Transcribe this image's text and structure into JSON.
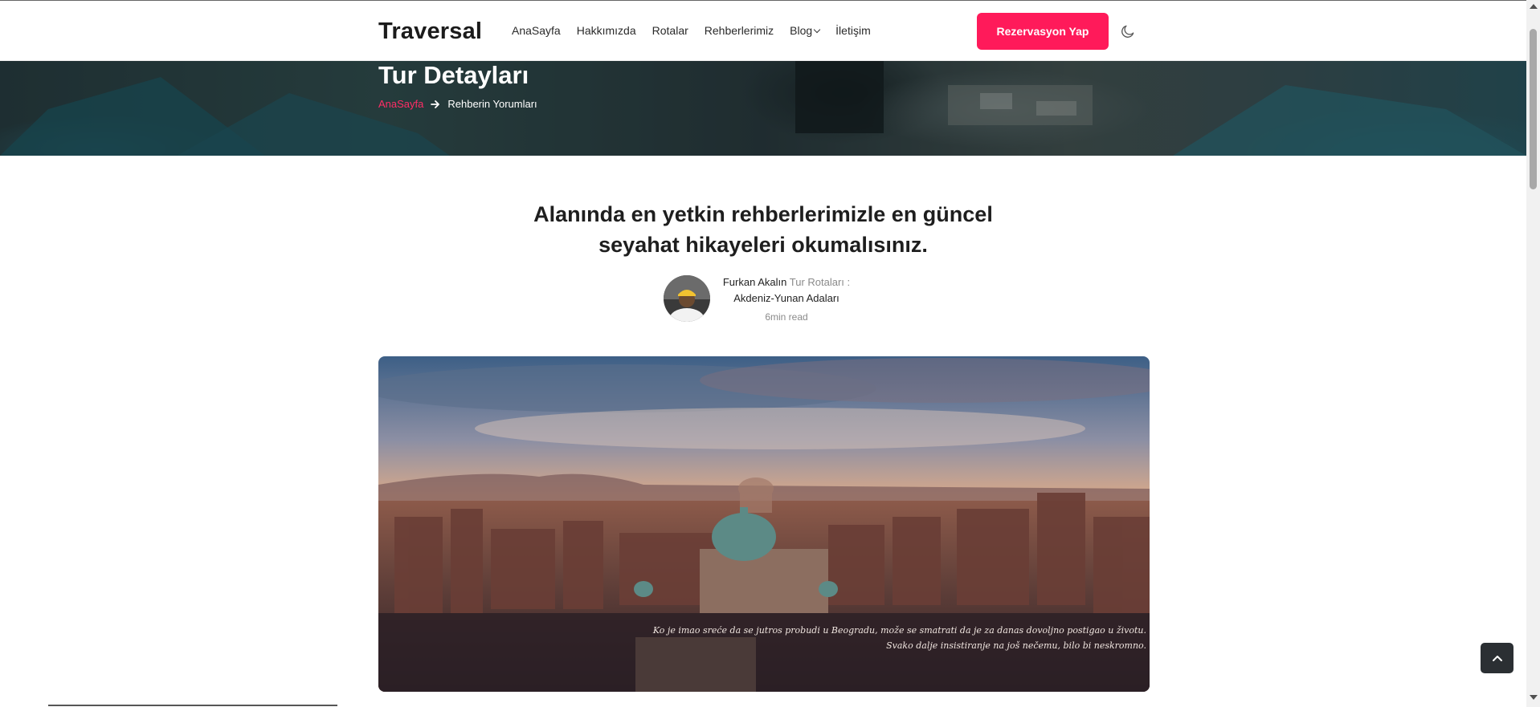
{
  "header": {
    "logo": "Traversal",
    "nav": [
      {
        "label": "AnaSayfa"
      },
      {
        "label": "Hakkımızda"
      },
      {
        "label": "Rotalar"
      },
      {
        "label": "Rehberlerimiz"
      },
      {
        "label": "Blog",
        "has_dropdown": true
      },
      {
        "label": "İletişim"
      }
    ],
    "cta_label": "Rezervasyon Yap",
    "theme_icon": "moon-icon",
    "accent_color": "#ff1a5a"
  },
  "hero": {
    "title": "Tur Detayları",
    "breadcrumb": {
      "home": "AnaSayfa",
      "separator_icon": "arrow-right-icon",
      "current": "Rehberin Yorumları"
    }
  },
  "article": {
    "headline_line1": "Alanında en yetkin rehberlerimizle en güncel",
    "headline_line2": "seyahat hikayeleri okumalısınız.",
    "author": {
      "name": "Furkan Akalın",
      "category_label": "Tur Rotaları :",
      "route": "Akdeniz-Yunan Adaları",
      "read_time": "6min read"
    },
    "image_caption_line1": "Ko je imao sreće da se jutros probudi u Beogradu, može se smatrati da je za danas dovoljno postigao u životu.",
    "image_caption_line2": "Svako dalje insistiranje na još nečemu, bilo bi neskromno."
  },
  "ui": {
    "scroll_top_icon": "chevron-up-icon"
  }
}
